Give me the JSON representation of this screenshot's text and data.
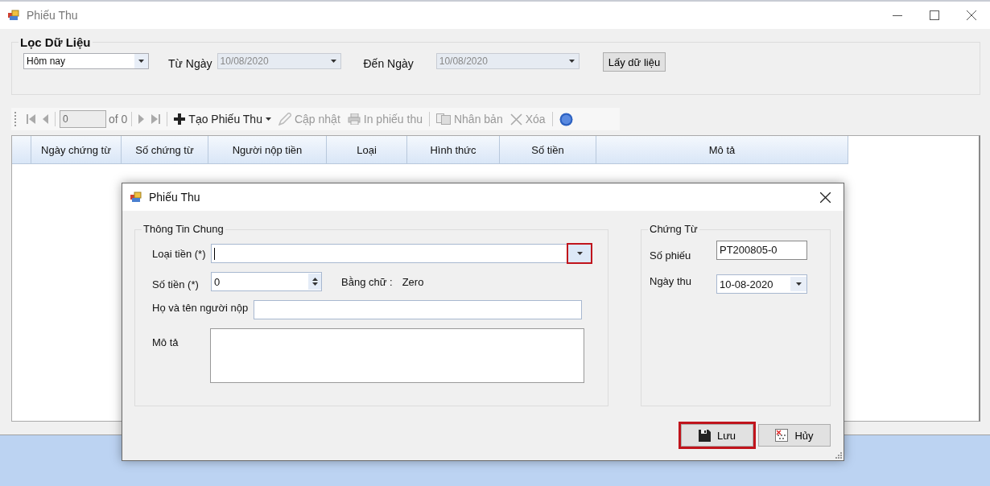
{
  "window": {
    "title": "Phiếu Thu"
  },
  "filter": {
    "title": "Lọc Dữ Liệu",
    "period": "Hôm nay",
    "from_label": "Từ Ngày",
    "from_date": {
      "value": "10/08/2020",
      "disabled": true
    },
    "to_label": "Đến Ngày",
    "to_date": {
      "value": "10/08/2020",
      "disabled": true
    },
    "fetch_button": "Lấy dữ liệu"
  },
  "toolbar": {
    "items": [
      {
        "kind": "first",
        "disabled": true
      },
      {
        "kind": "prev",
        "disabled": true
      },
      {
        "kind": "position",
        "value": "0",
        "disabled": true
      },
      {
        "kind": "count",
        "label": "of 0",
        "disabled": true
      },
      {
        "kind": "next",
        "disabled": true
      },
      {
        "kind": "last",
        "disabled": true
      },
      {
        "kind": "add",
        "label": "Tạo Phiếu Thu",
        "disabled": false
      },
      {
        "kind": "edit",
        "label": "Cập nhật",
        "disabled": true
      },
      {
        "kind": "print",
        "label": "In phiếu thu",
        "disabled": true
      },
      {
        "kind": "copy",
        "label": "Nhân bản",
        "disabled": true
      },
      {
        "kind": "delete",
        "label": "Xóa",
        "disabled": true
      },
      {
        "kind": "help",
        "disabled": false
      }
    ]
  },
  "table": {
    "columns": [
      "Ngày chứng từ",
      "Số chứng từ",
      "Người nộp tiền",
      "Loại",
      "Hình thức",
      "Số tiền",
      "Mô tả"
    ]
  },
  "dialog": {
    "title": "Phiếu Thu",
    "general": {
      "title": "Thông Tin Chung",
      "currency": {
        "label": "Loại tiền (*)",
        "dropdown_highlighted": true
      },
      "amount": {
        "label": "Số tiền (*)",
        "value": "0"
      },
      "in_words": {
        "label": "Bằng chữ :",
        "value": "Zero"
      },
      "payer": {
        "label": "Họ và tên người nộp"
      },
      "description": {
        "label": "Mô tả"
      }
    },
    "voucher": {
      "title": "Chứng Từ",
      "number": {
        "label": "Số phiếu",
        "value": "PT200805-0"
      },
      "date": {
        "label": "Ngày thu",
        "value": "10-08-2020"
      }
    },
    "buttons": [
      {
        "kind": "save",
        "label": "Lưu",
        "highlighted": true
      },
      {
        "kind": "cancel",
        "label": "Hủy",
        "highlighted": false
      }
    ]
  }
}
